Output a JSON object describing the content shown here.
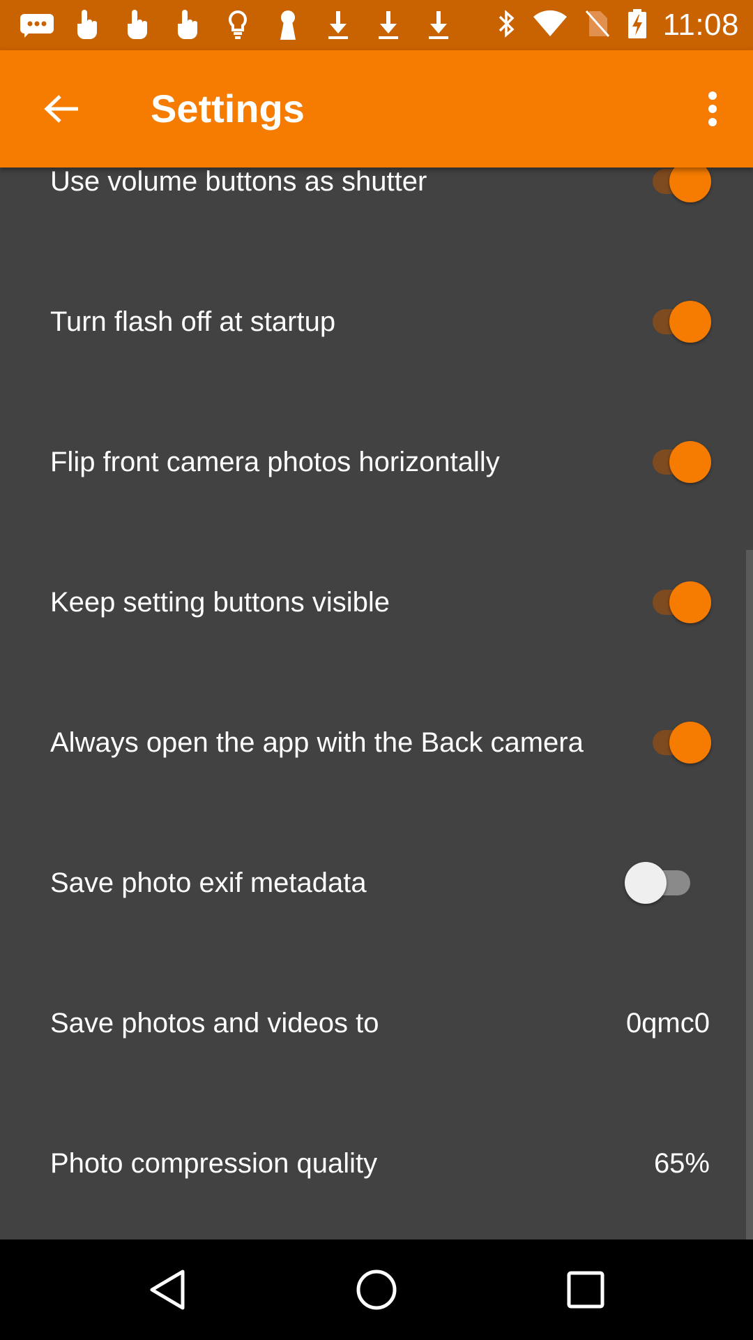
{
  "status_bar": {
    "time": "11:08",
    "icons_left": [
      "message-icon",
      "touch-icon",
      "touch-icon",
      "touch-icon",
      "lightbulb-icon",
      "keyhole-icon",
      "download-icon",
      "download-icon",
      "download-icon"
    ],
    "icons_right": [
      "bluetooth-icon",
      "wifi-icon",
      "no-sim-icon",
      "battery-charging-icon"
    ]
  },
  "app_bar": {
    "title": "Settings",
    "back_icon": "arrow-back-icon",
    "more_icon": "more-vert-icon",
    "color": "#f57c00"
  },
  "settings": [
    {
      "label": "Use volume buttons as shutter",
      "type": "switch",
      "checked": true
    },
    {
      "label": "Turn flash off at startup",
      "type": "switch",
      "checked": true
    },
    {
      "label": "Flip front camera photos horizontally",
      "type": "switch",
      "checked": true
    },
    {
      "label": "Keep setting buttons visible",
      "type": "switch",
      "checked": true
    },
    {
      "label": "Always open the app with the Back camera",
      "type": "switch",
      "checked": true
    },
    {
      "label": "Save photo exif metadata",
      "type": "switch",
      "checked": false
    },
    {
      "label": "Save photos and videos to",
      "type": "value",
      "value": "0qmc0"
    },
    {
      "label": "Photo compression quality",
      "type": "value",
      "value": "65%"
    }
  ],
  "nav_bar": {
    "icons": [
      "back-triangle-icon",
      "home-circle-icon",
      "recents-square-icon"
    ]
  },
  "colors": {
    "accent": "#f57c00",
    "status_bar": "#c96200",
    "background": "#424242"
  }
}
